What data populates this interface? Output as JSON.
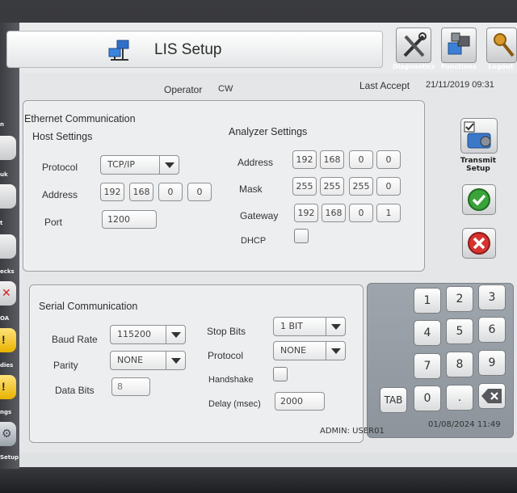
{
  "window": {
    "title": "LIS Setup"
  },
  "toolbar": {
    "diagnostics_label": "Diagnostics",
    "functions_label": "Functions",
    "logout_label": "Logout"
  },
  "left_strip": {
    "labels": [
      "n",
      "uk",
      "t",
      "ecks",
      "OA",
      "dies",
      "ngs",
      "Setup"
    ]
  },
  "header": {
    "operator_label": "Operator",
    "operator_value": "CW",
    "last_accept_label": "Last Accept",
    "last_accept_value": "21/11/2019 09:31"
  },
  "ethernet": {
    "section_title": "Ethernet Communication",
    "host": {
      "title": "Host Settings",
      "protocol_label": "Protocol",
      "protocol_value": "TCP/IP",
      "address_label": "Address",
      "address": [
        "192",
        "168",
        "0",
        "0"
      ],
      "port_label": "Port",
      "port_value": "1200"
    },
    "analyzer": {
      "title": "Analyzer Settings",
      "address_label": "Address",
      "address": [
        "192",
        "168",
        "0",
        "0"
      ],
      "mask_label": "Mask",
      "mask": [
        "255",
        "255",
        "255",
        "0"
      ],
      "gateway_label": "Gateway",
      "gateway": [
        "192",
        "168",
        "0",
        "1"
      ],
      "dhcp_label": "DHCP",
      "dhcp_checked": false
    }
  },
  "serial": {
    "section_title": "Serial Communication",
    "baud_rate_label": "Baud Rate",
    "baud_rate_value": "115200",
    "parity_label": "Parity",
    "parity_value": "NONE",
    "data_bits_label": "Data Bits",
    "data_bits_value": "8",
    "stop_bits_label": "Stop Bits",
    "stop_bits_value": "1 BIT",
    "protocol_label": "Protocol",
    "protocol_value": "NONE",
    "handshake_label": "Handshake",
    "handshake_checked": false,
    "delay_label": "Delay (msec)",
    "delay_value": "2000"
  },
  "actions": {
    "transmit_label": "Transmit\nSetup"
  },
  "keypad": {
    "keys": [
      "1",
      "2",
      "3",
      "4",
      "5",
      "6",
      "7",
      "8",
      "9",
      "TAB",
      "0",
      "."
    ]
  },
  "footer": {
    "user": "ADMIN: USER01",
    "datetime": "01/08/2024 11:49"
  },
  "colors": {
    "accept_green": "#3aa33a",
    "cancel_red": "#d8322f"
  }
}
